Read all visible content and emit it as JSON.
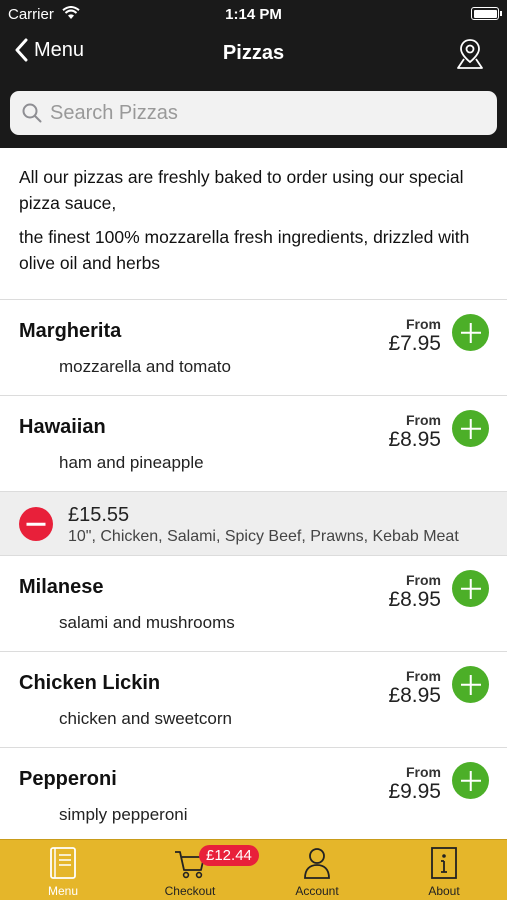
{
  "status": {
    "carrier": "Carrier",
    "time": "1:14 PM"
  },
  "nav": {
    "back_label": "Menu",
    "title": "Pizzas"
  },
  "search": {
    "placeholder": "Search Pizzas"
  },
  "intro": {
    "line1": "All our pizzas are freshly baked to order using our special pizza sauce,",
    "line2": "the finest 100% mozzarella fresh ingredients, drizzled with olive oil and herbs"
  },
  "items": [
    {
      "name": "Margherita",
      "desc": "mozzarella and tomato",
      "from": "From",
      "price": "£7.95"
    },
    {
      "name": "Hawaiian",
      "desc": "ham and pineapple",
      "from": "From",
      "price": "£8.95"
    },
    {
      "name": "Milanese",
      "desc": "salami and mushrooms",
      "from": "From",
      "price": "£8.95"
    },
    {
      "name": "Chicken Lickin",
      "desc": "chicken and sweetcorn",
      "from": "From",
      "price": "£8.95"
    },
    {
      "name": "Pepperoni",
      "desc": "simply pepperoni",
      "from": "From",
      "price": "£9.95"
    }
  ],
  "basket_line": {
    "price": "£15.55",
    "desc": "10\", Chicken, Salami, Spicy Beef, Prawns, Kebab Meat"
  },
  "tabs": {
    "menu": "Menu",
    "checkout": "Checkout",
    "checkout_badge": "£12.44",
    "account": "Account",
    "about": "About"
  },
  "colors": {
    "header": "#1a1a1a",
    "add": "#4caf28",
    "remove": "#e8203a",
    "tabbar": "#e5b62a"
  },
  "icons": [
    "wifi-icon",
    "battery-icon",
    "back-chevron-icon",
    "map-pin-icon",
    "search-icon",
    "add-icon",
    "remove-icon",
    "menu-book-icon",
    "cart-icon",
    "account-icon",
    "info-icon"
  ]
}
